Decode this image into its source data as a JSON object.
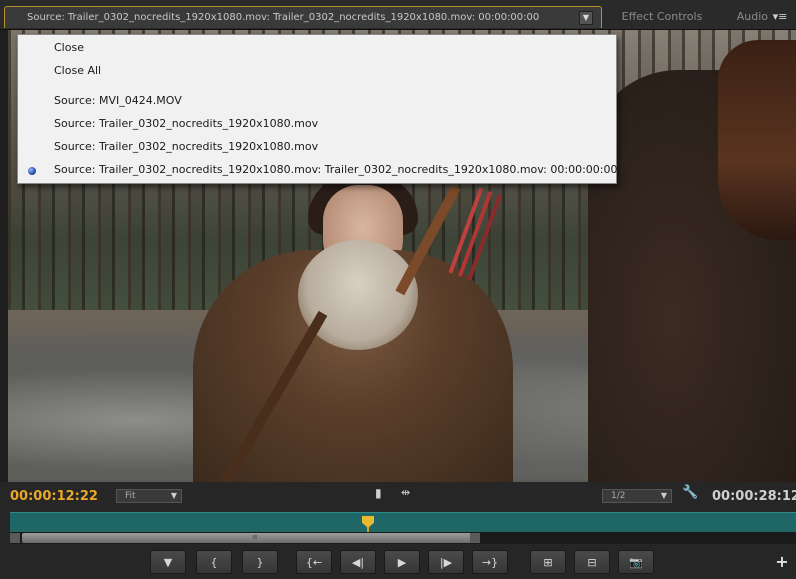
{
  "tabs": {
    "source_label": "Source: Trailer_0302_nocredits_1920x1080.mov: Trailer_0302_nocredits_1920x1080.mov: 00:00:00:00",
    "dropdown_glyph": "▼",
    "effect_controls": "Effect Controls",
    "audio": "Audio",
    "panel_menu_glyph": "▾≡"
  },
  "menu": {
    "items": [
      "Close",
      "Close All",
      "Source: MVI_0424.MOV",
      "Source: Trailer_0302_nocredits_1920x1080.mov",
      "Source: Trailer_0302_nocredits_1920x1080.mov",
      "Source: Trailer_0302_nocredits_1920x1080.mov: Trailer_0302_nocredits_1920x1080.mov: 00:00:00:00"
    ],
    "selected_index": 5
  },
  "controls": {
    "timecode_current": "00:00:12:22",
    "timecode_duration": "00:00:28:12",
    "fit_label": "Fit",
    "resolution_label": "1/2",
    "select_arrow": "▼",
    "marker_glyph": "▮",
    "insert_glyph": "⇹",
    "wrench_glyph": "🔧",
    "add_glyph": "+",
    "grip_glyph": "≡"
  },
  "transport": [
    {
      "name": "add-marker-button",
      "glyph": "▼"
    },
    {
      "name": "mark-in-button",
      "glyph": "{"
    },
    {
      "name": "mark-out-button",
      "glyph": "}"
    },
    {
      "name": "go-to-in-button",
      "glyph": "{←"
    },
    {
      "name": "step-back-button",
      "glyph": "◀|"
    },
    {
      "name": "play-button",
      "glyph": "▶"
    },
    {
      "name": "step-forward-button",
      "glyph": "|▶"
    },
    {
      "name": "go-to-out-button",
      "glyph": "→}"
    },
    {
      "name": "insert-button",
      "glyph": "⊞"
    },
    {
      "name": "overwrite-button",
      "glyph": "⊟"
    },
    {
      "name": "export-frame-button",
      "glyph": "📷"
    }
  ],
  "colors": {
    "timecode_active": "#e8a82a",
    "timeline_teal": "#1f6766",
    "playhead": "#e8b830",
    "tab_highlight": "#b8902a"
  }
}
